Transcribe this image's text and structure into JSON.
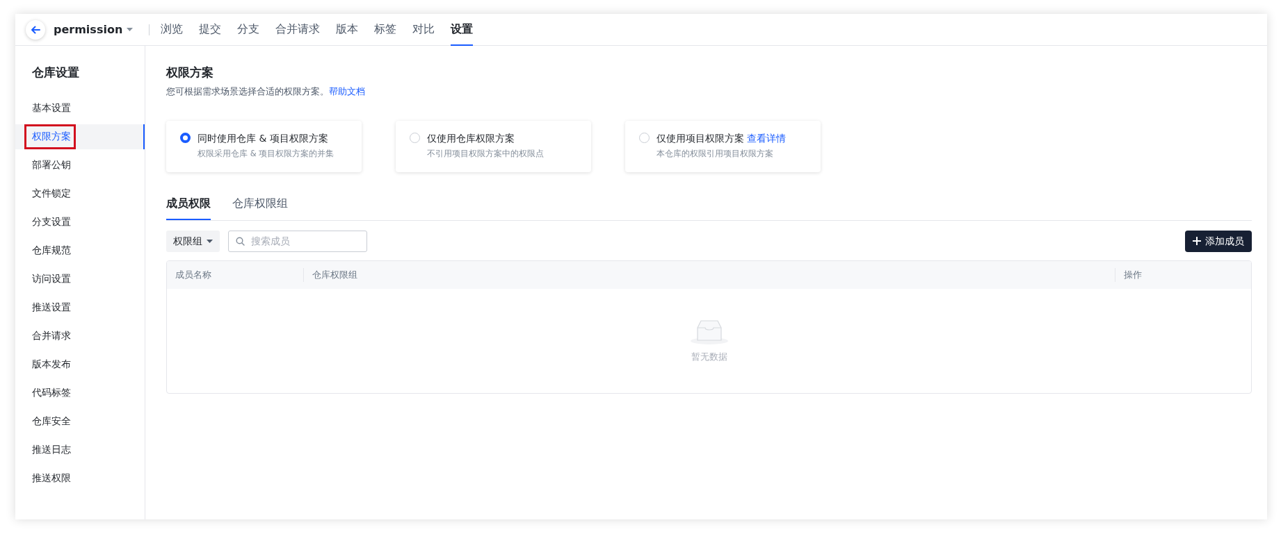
{
  "header": {
    "repo": "permission",
    "nav": [
      {
        "label": "浏览",
        "selected": false
      },
      {
        "label": "提交",
        "selected": false
      },
      {
        "label": "分支",
        "selected": false
      },
      {
        "label": "合并请求",
        "selected": false
      },
      {
        "label": "版本",
        "selected": false
      },
      {
        "label": "标签",
        "selected": false
      },
      {
        "label": "对比",
        "selected": false
      },
      {
        "label": "设置",
        "selected": true
      }
    ]
  },
  "sidebar": {
    "title": "仓库设置",
    "items": [
      {
        "label": "基本设置",
        "selected": false,
        "highlighted": false
      },
      {
        "label": "权限方案",
        "selected": true,
        "highlighted": true
      },
      {
        "label": "部署公钥",
        "selected": false,
        "highlighted": false
      },
      {
        "label": "文件锁定",
        "selected": false,
        "highlighted": false
      },
      {
        "label": "分支设置",
        "selected": false,
        "highlighted": false
      },
      {
        "label": "仓库规范",
        "selected": false,
        "highlighted": false
      },
      {
        "label": "访问设置",
        "selected": false,
        "highlighted": false
      },
      {
        "label": "推送设置",
        "selected": false,
        "highlighted": false
      },
      {
        "label": "合并请求",
        "selected": false,
        "highlighted": false
      },
      {
        "label": "版本发布",
        "selected": false,
        "highlighted": false
      },
      {
        "label": "代码标签",
        "selected": false,
        "highlighted": false
      },
      {
        "label": "仓库安全",
        "selected": false,
        "highlighted": false
      },
      {
        "label": "推送日志",
        "selected": false,
        "highlighted": false
      },
      {
        "label": "推送权限",
        "selected": false,
        "highlighted": false
      }
    ]
  },
  "main": {
    "title": "权限方案",
    "description": "您可根据需求场景选择合适的权限方案。",
    "help_link": "帮助文档",
    "schemes": [
      {
        "title": "同时使用仓库 & 项目权限方案",
        "subtitle": "权限采用仓库 & 项目权限方案的并集",
        "selected": true
      },
      {
        "title": "仅使用仓库权限方案",
        "subtitle": "不引用项目权限方案中的权限点",
        "selected": false
      },
      {
        "title": "仅使用项目权限方案",
        "link": "查看详情",
        "subtitle": "本仓库的权限引用项目权限方案",
        "selected": false
      }
    ],
    "tabs": [
      {
        "label": "成员权限",
        "selected": true
      },
      {
        "label": "仓库权限组",
        "selected": false
      }
    ],
    "filter": "权限组",
    "search": {
      "placeholder": "搜索成员"
    },
    "add_button": "添加成员",
    "table": {
      "columns": [
        "成员名称",
        "仓库权限组",
        "操作"
      ],
      "empty_text": "暂无数据"
    }
  }
}
